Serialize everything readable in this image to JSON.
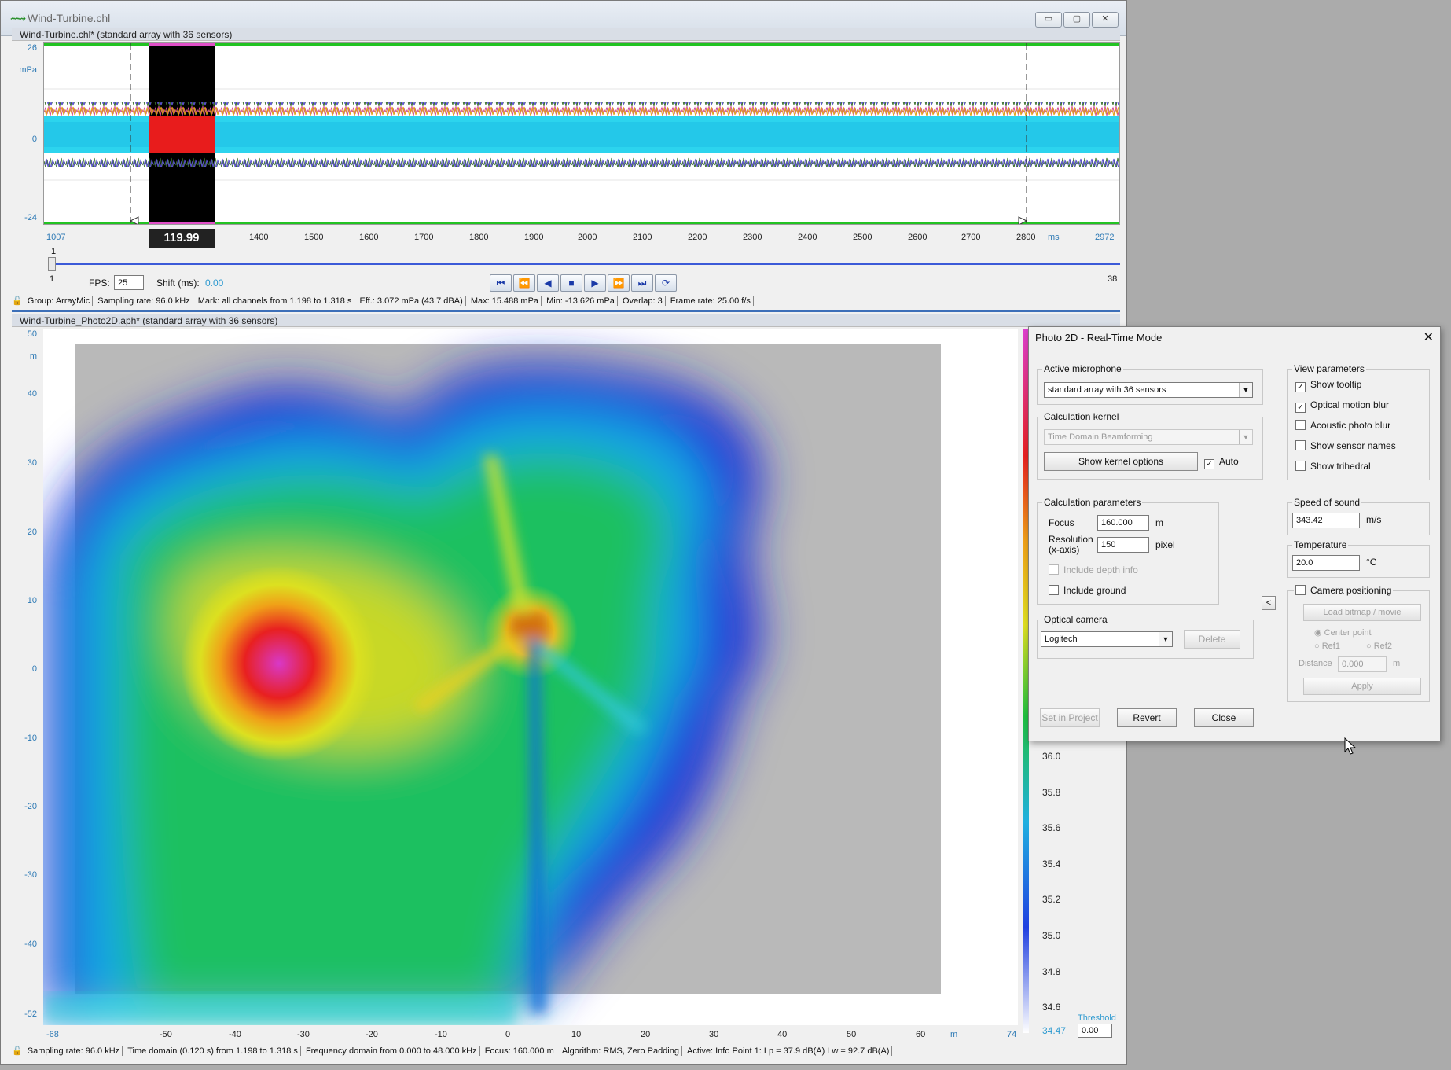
{
  "window": {
    "title": "Wind-Turbine.chl",
    "buttons": {
      "minimize": "▭",
      "maximize": "▢",
      "close": "✕"
    }
  },
  "timeseries": {
    "header": "Wind-Turbine.chl* (standard array with 36 sensors)",
    "y_unit": "mPa",
    "y_ticks": [
      "26",
      "0",
      "-24"
    ],
    "x_ticks": [
      "1007",
      "1400",
      "1500",
      "1600",
      "1700",
      "1800",
      "1900",
      "2000",
      "2100",
      "2200",
      "2300",
      "2400",
      "2500",
      "2600",
      "2700",
      "2800"
    ],
    "x_unit": "ms",
    "x_end": "2972",
    "selection_label": "119.99",
    "slider_top": "1",
    "slider_left": "1",
    "slider_right": "38",
    "fps_label": "FPS:",
    "fps_value": "25",
    "shift_label": "Shift (ms):",
    "shift_value": "0.00",
    "transport": [
      "⏮",
      "⏪",
      "◀",
      "■",
      "▶",
      "⏩",
      "⏭",
      "⟳"
    ],
    "status": [
      "Group: ArrayMic",
      "Sampling rate: 96.0 kHz",
      "Mark: all channels from 1.198 to 1.318 s",
      "Eff.: 3.072 mPa (43.7 dBA)",
      "Max: 15.488 mPa",
      "Min: -13.626 mPa",
      "Overlap: 3",
      "Frame rate: 25.00 f/s"
    ]
  },
  "photo": {
    "header": "Wind-Turbine_Photo2D.aph* (standard array with 36 sensors)",
    "y_unit": "m",
    "y_ticks": [
      "50",
      "40",
      "30",
      "20",
      "10",
      "0",
      "-10",
      "-20",
      "-30",
      "-40",
      "-52"
    ],
    "x_ticks": [
      "-68",
      "-50",
      "-40",
      "-30",
      "-20",
      "-10",
      "0",
      "10",
      "20",
      "30",
      "40",
      "50",
      "60"
    ],
    "x_unit": "m",
    "x_end": "74",
    "colorbar_ticks": [
      "36.0",
      "35.8",
      "35.6",
      "35.4",
      "35.2",
      "35.0",
      "34.8",
      "34.6",
      "34.47"
    ],
    "threshold_label": "Threshold",
    "threshold_value": "0.00",
    "status": [
      "Sampling rate: 96.0 kHz",
      "Time domain (0.120 s) from 1.198 to 1.318 s",
      "Frequency domain from 0.000 to 48.000 kHz",
      "Focus: 160.000 m",
      "Algorithm: RMS, Zero Padding",
      "Active: Info Point 1: Lp = 37.9 dB(A) Lw = 92.7 dB(A)"
    ]
  },
  "dialog": {
    "title": "Photo 2D - Real-Time Mode",
    "close": "✕",
    "active_microphone": {
      "label": "Active microphone",
      "value": "standard array with 36 sensors"
    },
    "calc_kernel": {
      "label": "Calculation kernel",
      "value": "Time Domain Beamforming",
      "options_button": "Show kernel options",
      "auto_label": "Auto"
    },
    "calc_params": {
      "label": "Calculation parameters",
      "focus_label": "Focus",
      "focus_value": "160.000",
      "focus_unit": "m",
      "res_label1": "Resolution",
      "res_label2": "(x-axis)",
      "res_value": "150",
      "res_unit": "pixel",
      "depth_label": "Include depth info",
      "ground_label": "Include ground"
    },
    "optical_camera": {
      "label": "Optical camera",
      "value": "Logitech",
      "delete": "Delete"
    },
    "buttons": {
      "set_in_project": "Set in Project",
      "revert": "Revert",
      "close": "Close"
    },
    "collapse": "<",
    "view_params": {
      "label": "View parameters",
      "items": [
        {
          "label": "Show tooltip",
          "checked": true
        },
        {
          "label": "Optical motion blur",
          "checked": true
        },
        {
          "label": "Acoustic photo blur",
          "checked": false
        },
        {
          "label": "Show sensor names",
          "checked": false
        },
        {
          "label": "Show trihedral",
          "checked": false
        }
      ]
    },
    "speed_of_sound": {
      "label": "Speed of sound",
      "value": "343.42",
      "unit": "m/s"
    },
    "temperature": {
      "label": "Temperature",
      "value": "20.0",
      "unit": "°C"
    },
    "camera_positioning": {
      "label": "Camera positioning",
      "load": "Load bitmap / movie",
      "center": "Center point",
      "ref1": "Ref1",
      "ref2": "Ref2",
      "distance_label": "Distance",
      "distance_value": "0.000",
      "distance_unit": "m",
      "apply": "Apply"
    }
  }
}
